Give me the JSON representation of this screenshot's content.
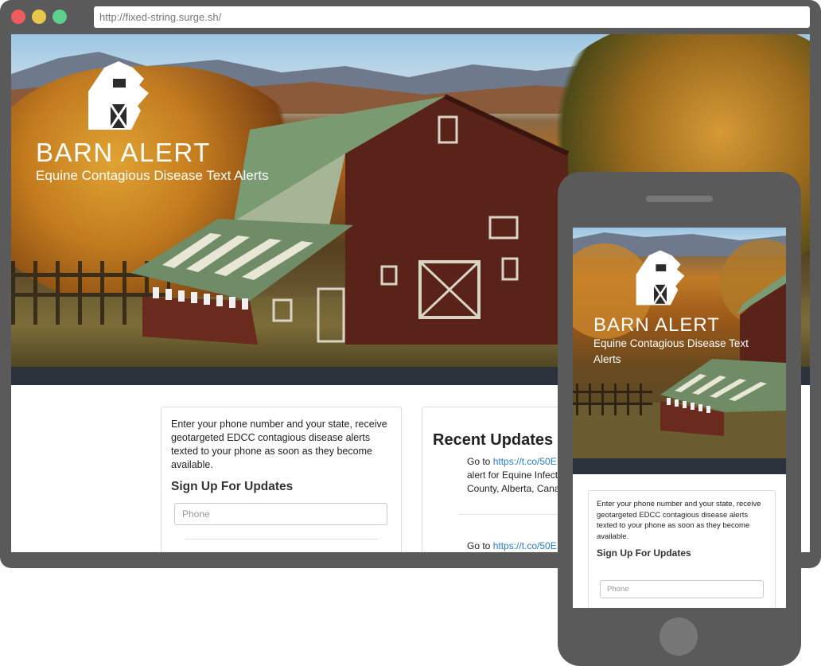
{
  "browser": {
    "url": "http://fixed-string.surge.sh/"
  },
  "hero": {
    "title": "BARN ALERT",
    "subtitle": "Equine Contagious Disease Text Alerts",
    "logo_icon": "barn-logo-icon"
  },
  "signup": {
    "description": "Enter your phone number and your state, receive geotargeted EDCC contagious disease alerts texted to your phone as soon as they become available.",
    "heading": "Sign Up For Updates",
    "phone_placeholder": "Phone"
  },
  "updates": {
    "title": "Recent Updates",
    "items": [
      {
        "prefix": "Go to ",
        "link": "https://t.co/50E",
        "line2": "alert for Equine Infecti",
        "line3": "County, Alberta, Cana"
      },
      {
        "prefix": "Go to ",
        "link": "https://t.co/50E"
      }
    ]
  },
  "colors": {
    "frame": "#5a5a5a",
    "close_dot": "#ee5c5c",
    "minimize_dot": "#e8c64a",
    "maximize_dot": "#5cd08c",
    "nav_strip": "#2a323b",
    "link": "#2a7bc0"
  }
}
